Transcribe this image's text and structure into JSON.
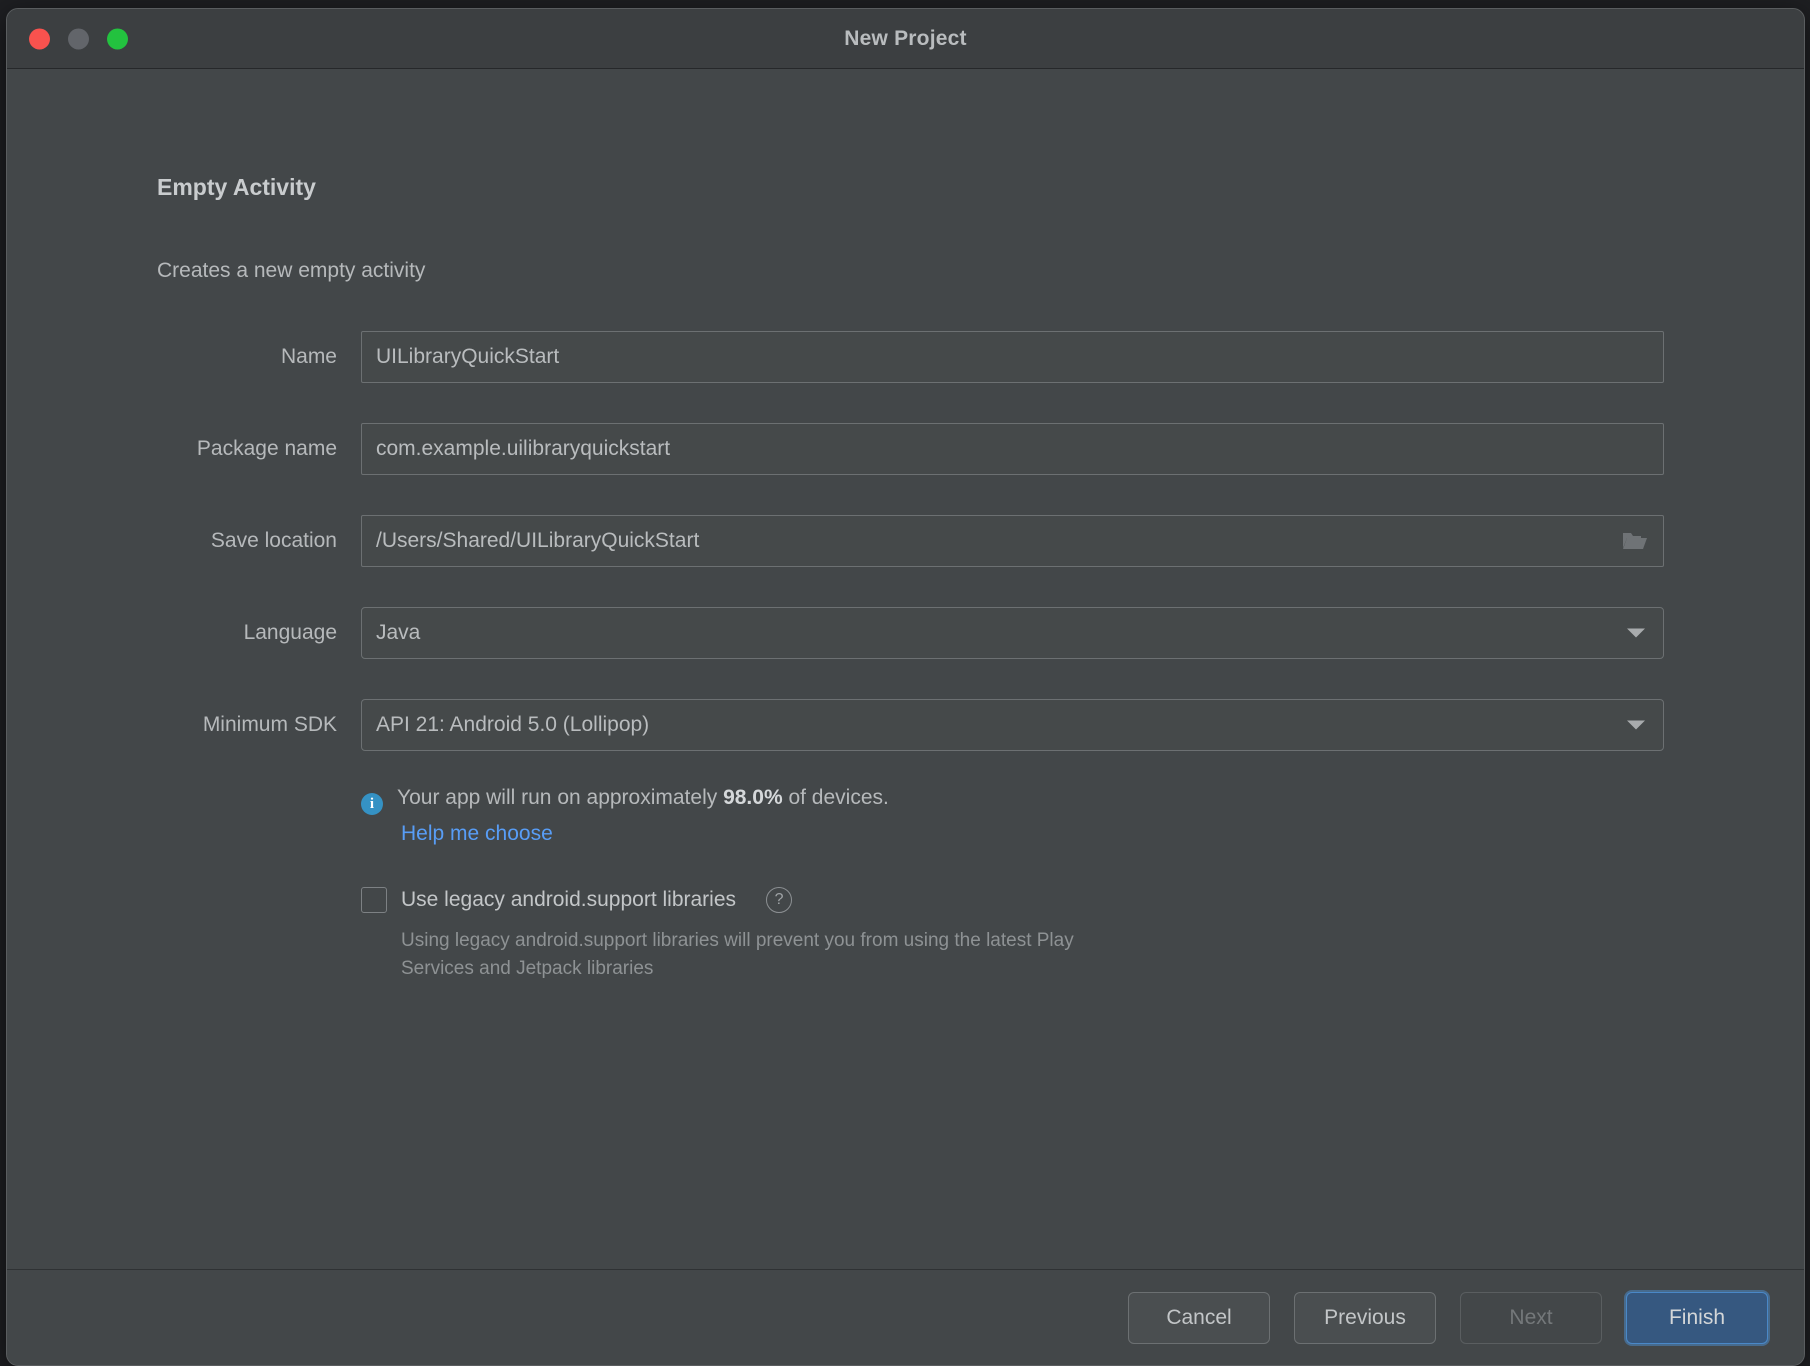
{
  "window": {
    "title": "New Project",
    "traffic_lights": [
      "close-button",
      "minimize-button",
      "zoom-button"
    ]
  },
  "content": {
    "heading": "Empty Activity",
    "subheading": "Creates a new empty activity"
  },
  "form": {
    "fields": [
      {
        "label": "Name",
        "value": "UILibraryQuickStart",
        "placeholder": "Name",
        "type": "text"
      },
      {
        "label": "Package name",
        "value": "com.example.uilibraryquickstart",
        "placeholder": "Package name",
        "type": "text"
      },
      {
        "label": "Save location",
        "value": "/Users/Shared/UILibraryQuickStart",
        "placeholder": "Save location",
        "type": "text-with-browse",
        "browse_icon": "folder-icon"
      },
      {
        "label": "Language",
        "value": "Java",
        "type": "combo",
        "icon": "chevron-down-icon"
      },
      {
        "label": "Minimum SDK",
        "value": "API 21: Android 5.0 (Lollipop)",
        "type": "combo",
        "icon": "chevron-down-icon"
      }
    ]
  },
  "info": {
    "icon": "info-icon",
    "text_before": "Your app will run on approximately ",
    "percent": "98.0%",
    "text_after": " of devices.",
    "link": "Help me choose",
    "link_color": "#589df6"
  },
  "legacy": {
    "checked": false,
    "label": "Use legacy android.support libraries",
    "help_icon": "question-mark-icon",
    "description": "Using legacy android.support libraries will prevent you from using the latest Play Services and Jetpack libraries"
  },
  "footer": {
    "buttons": [
      {
        "label": "Cancel",
        "state": "enabled"
      },
      {
        "label": "Previous",
        "state": "enabled"
      },
      {
        "label": "Next",
        "state": "disabled"
      },
      {
        "label": "Finish",
        "state": "primary"
      }
    ]
  },
  "colors": {
    "dialog_bg": "#434749",
    "titlebar_bg": "#3c3f41",
    "field_bg": "#45494a",
    "accent_blue": "#365880",
    "link_blue": "#589df6",
    "info_blue": "#3592c4"
  }
}
